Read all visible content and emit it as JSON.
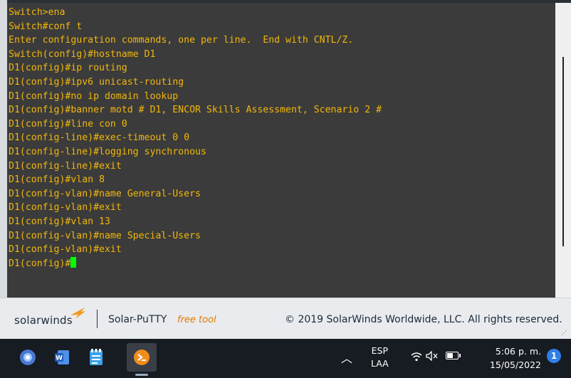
{
  "terminal": {
    "lines": [
      "Switch>ena",
      "Switch#conf t",
      "Enter configuration commands, one per line.  End with CNTL/Z.",
      "Switch(config)#hostname D1",
      "D1(config)#ip routing",
      "D1(config)#ipv6 unicast-routing",
      "D1(config)#no ip domain lookup",
      "D1(config)#banner motd # D1, ENCOR Skills Assessment, Scenario 2 #",
      "D1(config)#line con 0",
      "D1(config-line)#exec-timeout 0 0",
      "D1(config-line)#logging synchronous",
      "D1(config-line)#exit",
      "D1(config)#vlan 8",
      "D1(config-vlan)#name General-Users",
      "D1(config-vlan)#exit",
      "D1(config)#vlan 13",
      "D1(config-vlan)#name Special-Users",
      "D1(config-vlan)#exit"
    ],
    "prompt": "D1(config)#",
    "text_color": "#f2b70a",
    "cursor_color": "#00ff00"
  },
  "footer": {
    "brand": "solarwinds",
    "product": "Solar-PuTTY",
    "product_tag": "free tool",
    "copyright": "© 2019 SolarWinds Worldwide, LLC. All rights reserved."
  },
  "taskbar": {
    "apps": [
      "browser-icon",
      "word-icon",
      "notepad-icon",
      "solar-putty-icon"
    ],
    "tray": {
      "lang_top": "ESP",
      "lang_bottom": "LAA",
      "time": "5:06 p. m.",
      "date": "15/05/2022",
      "notifications": "1"
    }
  }
}
